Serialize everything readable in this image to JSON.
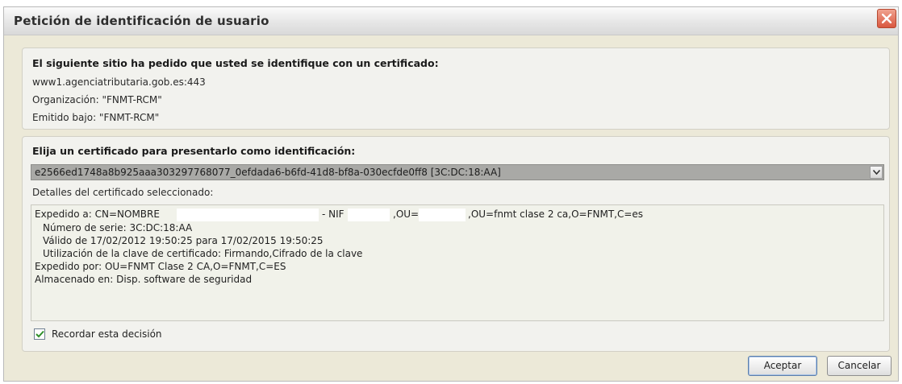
{
  "window": {
    "title": "Petición de identificación de usuario"
  },
  "site_section": {
    "heading": "El siguiente sitio ha pedido que usted se identifique con un certificado:",
    "host": "www1.agenciatributaria.gob.es:443",
    "organization": "Organización: \"FNMT-RCM\"",
    "issued_under": "Emitido bajo: \"FNMT-RCM\""
  },
  "certificate_section": {
    "heading": "Elija un certificado para presentarlo como identificación:",
    "selected_certificate": "e2566ed1748a8b925aaa303297768077_0efdada6-b6fd-41d8-bf8a-030ecfde0ff8 [3C:DC:18:AA]",
    "details_label": "Detalles del certificado seleccionado:",
    "details": {
      "issued_to_prefix": "Expedido a: CN=NOMBRE",
      "nif_label": "- NIF",
      "ou_label": ",OU=",
      "ou_suffix": ",OU=fnmt clase 2 ca,O=FNMT,C=es",
      "serial": "Número de serie: 3C:DC:18:AA",
      "validity": "Válido de 17/02/2012 19:50:25 para 17/02/2015 19:50:25",
      "key_usage": "Utilización de la clave de certificado: Firmando,Cifrado de la clave",
      "issued_by": "Expedido por: OU=FNMT Clase 2 CA,O=FNMT,C=ES",
      "stored_in": "Almacenado en: Disp. software de seguridad"
    },
    "remember_label": "Recordar esta decisión",
    "remember_checked": true
  },
  "buttons": {
    "accept": "Aceptar",
    "cancel": "Cancelar"
  },
  "colors": {
    "close_button": "#d9573f",
    "selected_row": "#a9a9a6",
    "panel_bg": "#f2f2ee"
  }
}
